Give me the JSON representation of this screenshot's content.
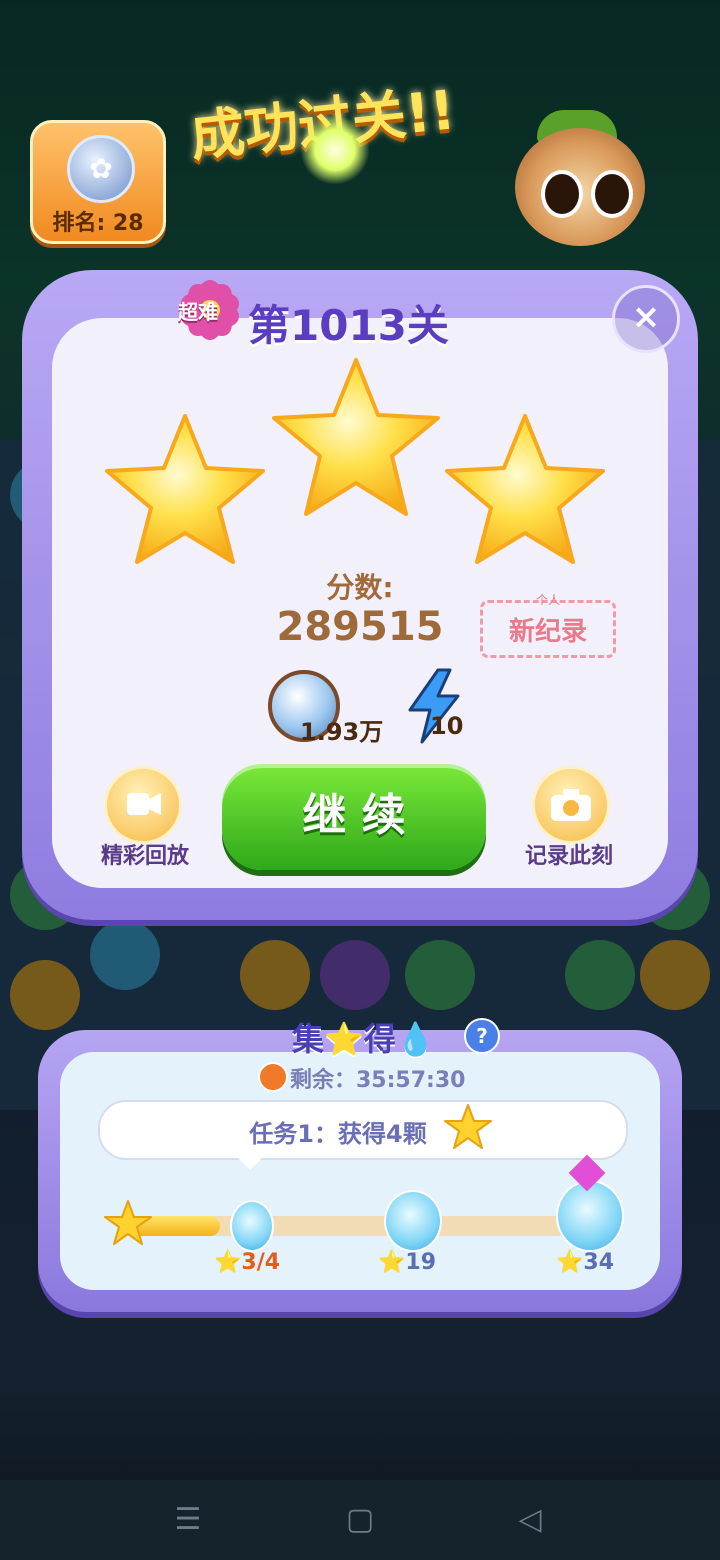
{
  "rank": {
    "label": "排名: 28"
  },
  "banner": {
    "title": "成功过关!!"
  },
  "level": {
    "difficulty": "超难",
    "title": "第1013关"
  },
  "result": {
    "stars_earned": 3,
    "stars_total": 3,
    "score_label": "分数:",
    "score_value": "289515",
    "record_small": "个人",
    "record_label": "新纪录",
    "coin_reward": "1.93万",
    "bolt_reward": "10"
  },
  "buttons": {
    "continue": "继 续",
    "replay": "精彩回放",
    "capture": "记录此刻",
    "close": "×"
  },
  "collect": {
    "title": "集⭐得💧",
    "timer": "剩余：35:57:30",
    "task": "任务1：获得4颗",
    "progress_current": 3,
    "progress_target": 4,
    "milestones": [
      {
        "label": "3/4"
      },
      {
        "label": "19"
      },
      {
        "label": "34"
      }
    ]
  },
  "colors": {
    "panel_frame": "#8f7ce0",
    "continue_green": "#2ea81a",
    "star_gold": "#ffc21a",
    "level_title": "#5a3dc0"
  },
  "icons": [
    "rank-shield-icon",
    "close-icon",
    "star-icon",
    "coin-icon",
    "bolt-icon",
    "video-replay-icon",
    "camera-icon",
    "timer-icon",
    "help-icon",
    "water-drop-bottle-icon",
    "menu-icon",
    "home-icon",
    "back-icon"
  ]
}
